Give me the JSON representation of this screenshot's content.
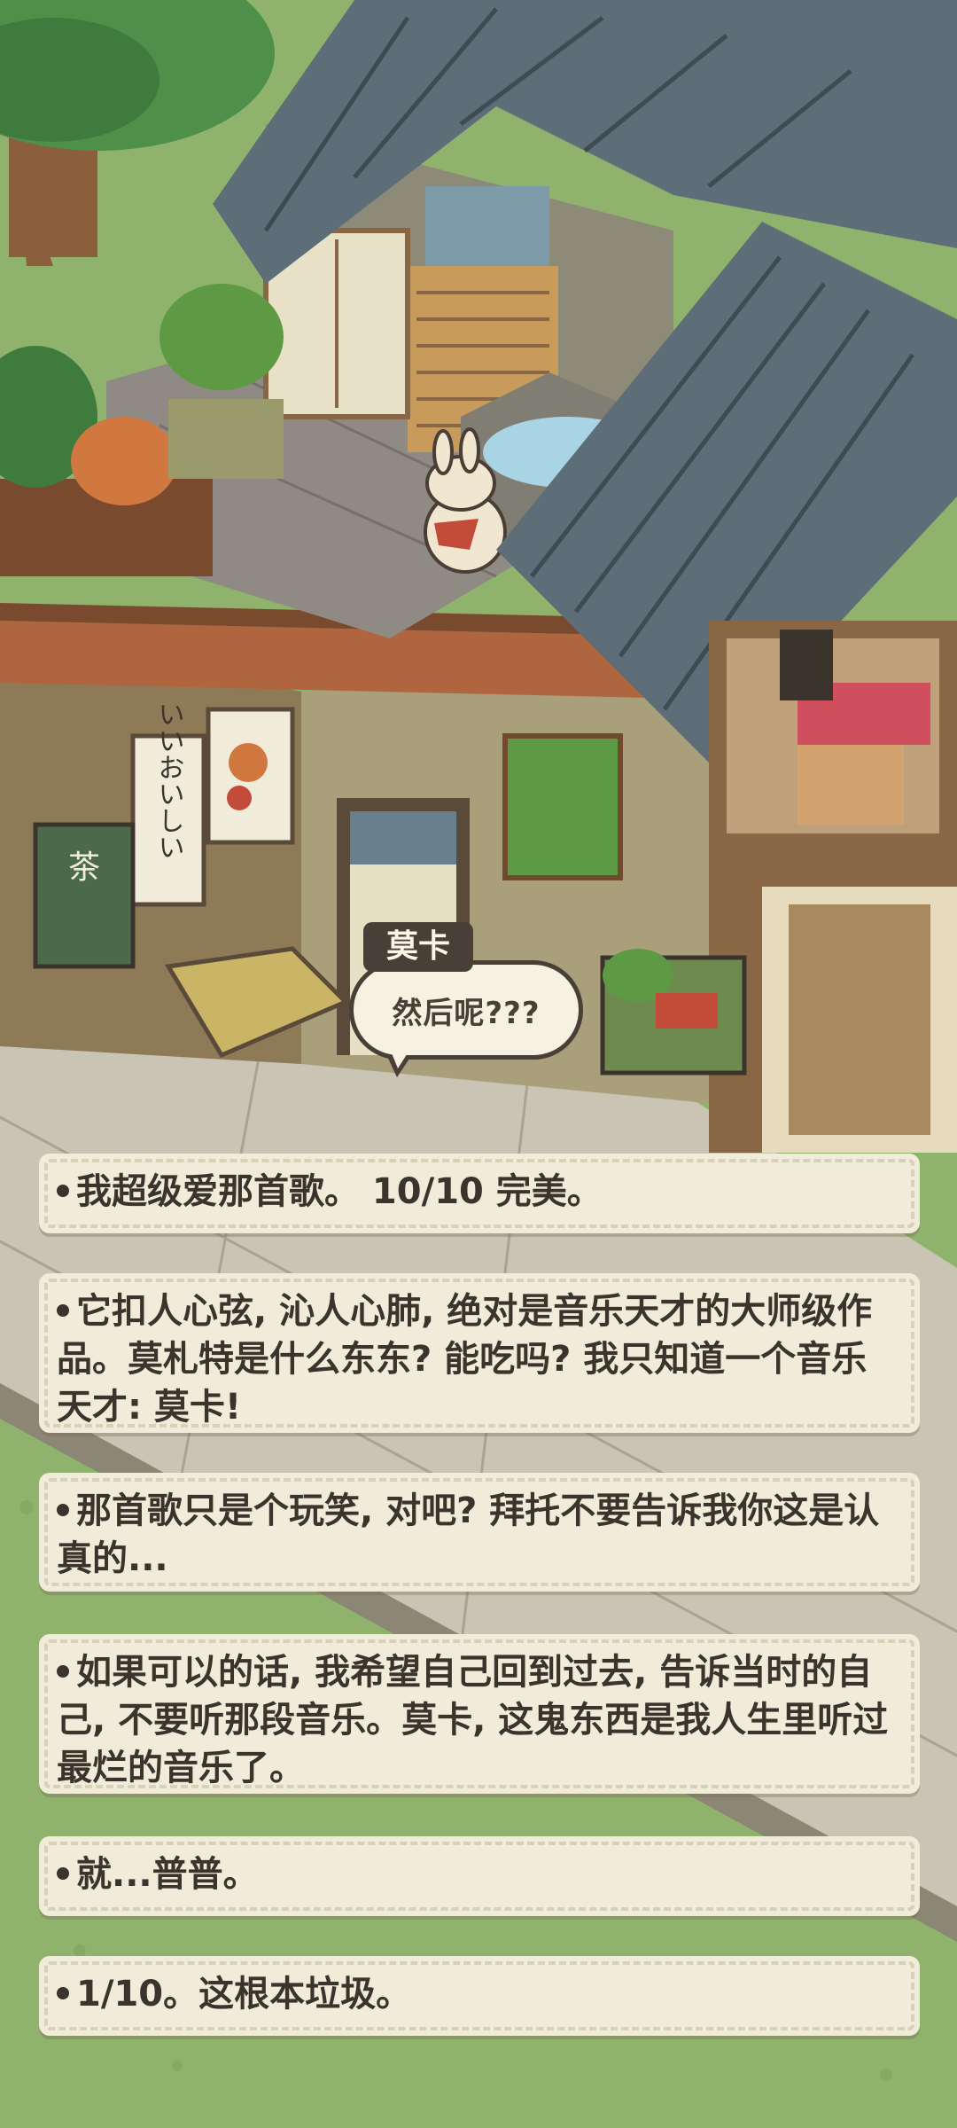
{
  "speaker": {
    "name": "莫卡",
    "line": "然后呢???"
  },
  "signs": {
    "vertical_sign": "いいおいしい",
    "tea_sign": "茶"
  },
  "choices": [
    {
      "text": "我超级爱那首歌。 10/10 完美。"
    },
    {
      "text": "它扣人心弦, 沁人心肺, 绝对是音乐天才的大师级作品。莫札特是什么东东? 能吃吗? 我只知道一个音乐天才: 莫卡!"
    },
    {
      "text": "那首歌只是个玩笑, 对吧? 拜托不要告诉我你这是认真的..."
    },
    {
      "text": "如果可以的话, 我希望自己回到过去, 告诉当时的自己, 不要听那段音乐。莫卡, 这鬼东西是我人生里听过最烂的音乐了。"
    },
    {
      "text": "就...普普。"
    },
    {
      "text": "1/10。这根本垃圾。"
    }
  ],
  "colors": {
    "grass": "#8fb36c",
    "roof": "#5d6e78",
    "wood": "#8a6744",
    "wall": "#a99f7a",
    "card_bg": "#f1ecd9",
    "text_dark": "#3b342d"
  }
}
